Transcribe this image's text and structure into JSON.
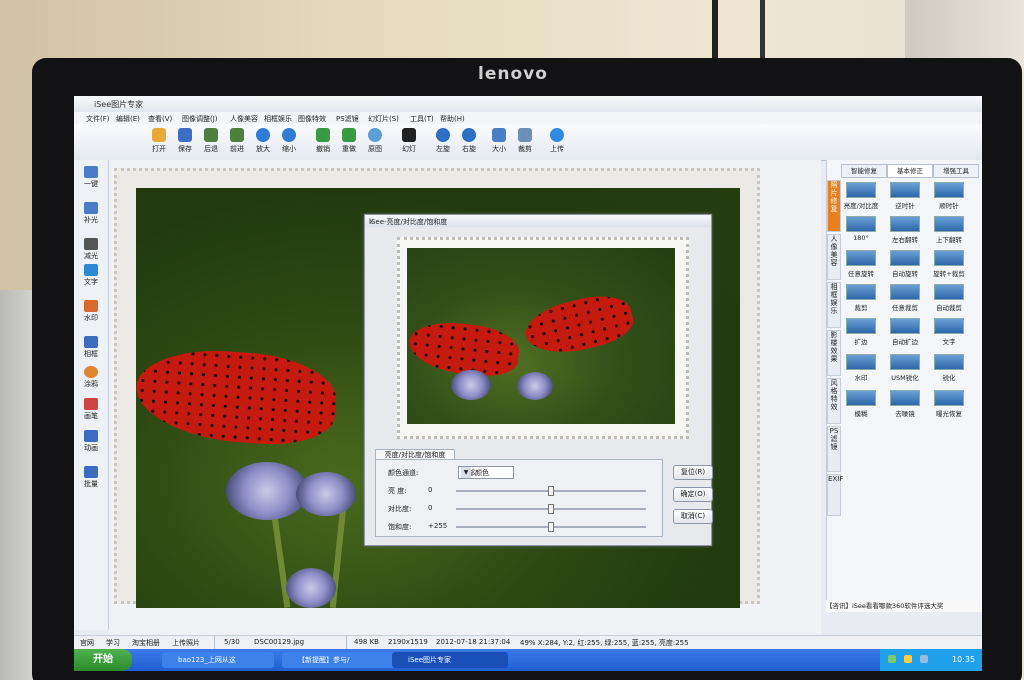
{
  "monitor": {
    "brand": "lenovo"
  },
  "app": {
    "title": "iSee图片专家",
    "menu": [
      "文件(F)",
      "编辑(E)",
      "查看(V)",
      "图像调整(J)",
      "人像美容",
      "相框娱乐",
      "图像特效",
      "PS滤镜",
      "幻灯片(S)",
      "工具(T)",
      "帮助(H)"
    ],
    "toolbar": [
      "打开",
      "保存",
      "后退",
      "前进",
      "放大",
      "缩小",
      "撤销",
      "重做",
      "原图",
      "幻灯",
      "左旋",
      "右旋",
      "大小",
      "裁剪",
      "上传"
    ],
    "left_tools": [
      "一键",
      "补光",
      "减光",
      "文字",
      "水印",
      "相框",
      "涂鸦",
      "画笔",
      "动画",
      "批量"
    ]
  },
  "right_panel": {
    "tabs": [
      "智能修复",
      "基本修正",
      "增强工具"
    ],
    "active_tab": "基本修正",
    "vertical_tabs": [
      "照片修复",
      "人像美容",
      "相框娱乐",
      "影楼效果",
      "风格特效",
      "PS滤镜",
      "EXIF"
    ],
    "tools": [
      [
        "亮度/对比度",
        "逆时针",
        "顺时针"
      ],
      [
        "180°",
        "左右翻转",
        "上下翻转"
      ],
      [
        "任意旋转",
        "自动旋转",
        "旋转+裁剪"
      ],
      [
        "裁剪",
        "任意裁剪",
        "自动裁剪"
      ],
      [
        "扩边",
        "自动扩边",
        "文字"
      ],
      [
        "水印",
        "USM锐化",
        "锐化"
      ],
      [
        "模糊",
        "去噪镜",
        "曝光恢复"
      ]
    ],
    "news": "【咨讯】iSee看看哪款360软件评选大奖"
  },
  "dialog": {
    "title": "iSee-亮度/对比度/饱和度",
    "close": "x",
    "tab": "亮度/对比度/饱和度",
    "channel_label": "颜色通道:",
    "channel_value": "全部颜色",
    "rows": [
      {
        "label": "亮  度:",
        "value": "0",
        "level": 0.5
      },
      {
        "label": "对比度:",
        "value": "0",
        "level": 0.5
      },
      {
        "label": "饱和度:",
        "value": "+255",
        "level": 0.5
      }
    ],
    "buttons": [
      "复位(R)",
      "确定(O)",
      "取消(C)"
    ]
  },
  "statusbar": {
    "left": [
      "官网",
      "学习",
      "淘宝相册",
      "上传照片"
    ],
    "page": "5/30",
    "filename": "DSC00129.jpg",
    "filesize": "498 KB",
    "dimensions": "2190x1519",
    "datetime": "2012-07-18 21:37:04",
    "info": "49% X:284, Y:2, 红:255, 绿:255, 蓝:255, 亮度:255"
  },
  "taskbar": {
    "start": "开始",
    "tasks": [
      "bao123_上网从这",
      "【新提醒】参与/",
      "iSee图片专家"
    ],
    "active_task": "iSee图片专家",
    "clock": "10:35"
  }
}
